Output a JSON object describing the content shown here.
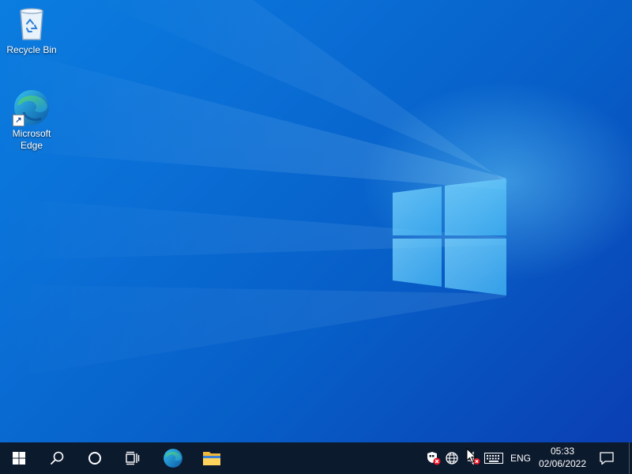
{
  "desktop": {
    "icons": [
      {
        "label": "Recycle Bin",
        "icon": "recycle-bin-icon"
      },
      {
        "label": "Microsoft\nEdge",
        "label_line1": "Microsoft",
        "label_line2": "Edge",
        "icon": "edge-icon"
      }
    ],
    "wallpaper": "windows-10-logo-light"
  },
  "taskbar": {
    "start_icon": "windows-logo-icon",
    "search_icon": "search-icon",
    "cortana_icon": "cortana-circle-icon",
    "taskview_icon": "task-view-icon",
    "pinned": [
      {
        "name": "Microsoft Edge",
        "icon": "edge-icon"
      },
      {
        "name": "File Explorer",
        "icon": "folder-icon"
      }
    ],
    "tray": {
      "defender_icon": "shield-alert-icon",
      "network_icon": "globe-no-internet-icon",
      "volume_icon": "speaker-muted-icon",
      "keyboard_icon": "touch-keyboard-icon",
      "language": "ENG"
    },
    "clock": {
      "time": "05:33",
      "date": "02/06/2022"
    },
    "notification_icon": "action-center-icon"
  },
  "colors": {
    "taskbar_bg": "#0c1a2e",
    "wallpaper_accent": "#0a6fd6",
    "alert_red": "#e81123"
  }
}
